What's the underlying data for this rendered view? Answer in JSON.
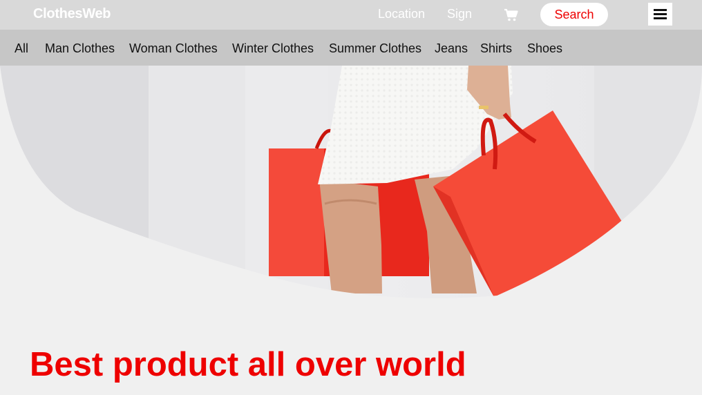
{
  "header": {
    "logo": "ClothesWeb",
    "nav": {
      "location": "Location",
      "sign": "Sign"
    },
    "cart_icon": "cart-icon",
    "search_label": "Search",
    "menu_icon": "hamburger-icon"
  },
  "categories": [
    "All",
    "Man Clothes",
    "Woman Clothes",
    "Winter Clothes",
    "Summer Clothes",
    "Jeans",
    "Shirts",
    "Shoes"
  ],
  "hero": {
    "image_description": "legs-white-dress-red-shopping-bags"
  },
  "headline": "Best product all over world",
  "colors": {
    "accent": "#ee0000",
    "topbar": "#d9d9d9",
    "catbar": "#c6c6c6",
    "page_bg": "#f0f0f0",
    "bag_red": "#f13a2c"
  }
}
